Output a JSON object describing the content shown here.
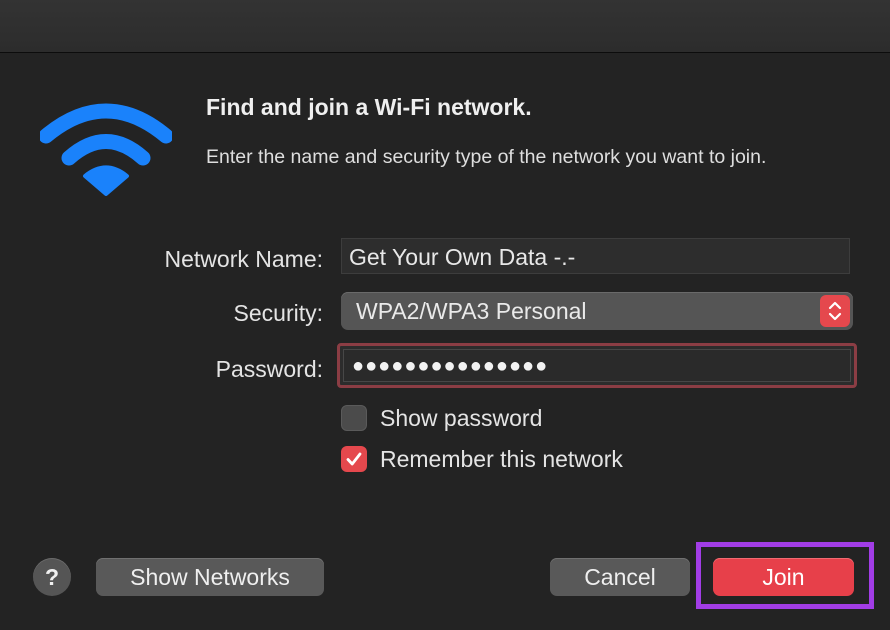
{
  "window": {
    "icon": "wifi-icon",
    "heading": "Find and join a Wi-Fi network.",
    "description": "Enter the name and security type of the network you want to join."
  },
  "form": {
    "network_name_label": "Network Name:",
    "network_name_value": "Get Your Own Data -.-",
    "security_label": "Security:",
    "security_value": "WPA2/WPA3 Personal",
    "password_label": "Password:",
    "password_value": "●●●●●●●●●●●●●●●",
    "show_password_label": "Show password",
    "show_password_checked": false,
    "remember_label": "Remember this network",
    "remember_checked": true
  },
  "footer": {
    "help_label": "?",
    "show_networks_label": "Show Networks",
    "cancel_label": "Cancel",
    "join_label": "Join"
  },
  "colors": {
    "accent": "#e7404a",
    "wifi_icon": "#1a82fb",
    "highlight": "#a23de6",
    "background": "#232323"
  }
}
